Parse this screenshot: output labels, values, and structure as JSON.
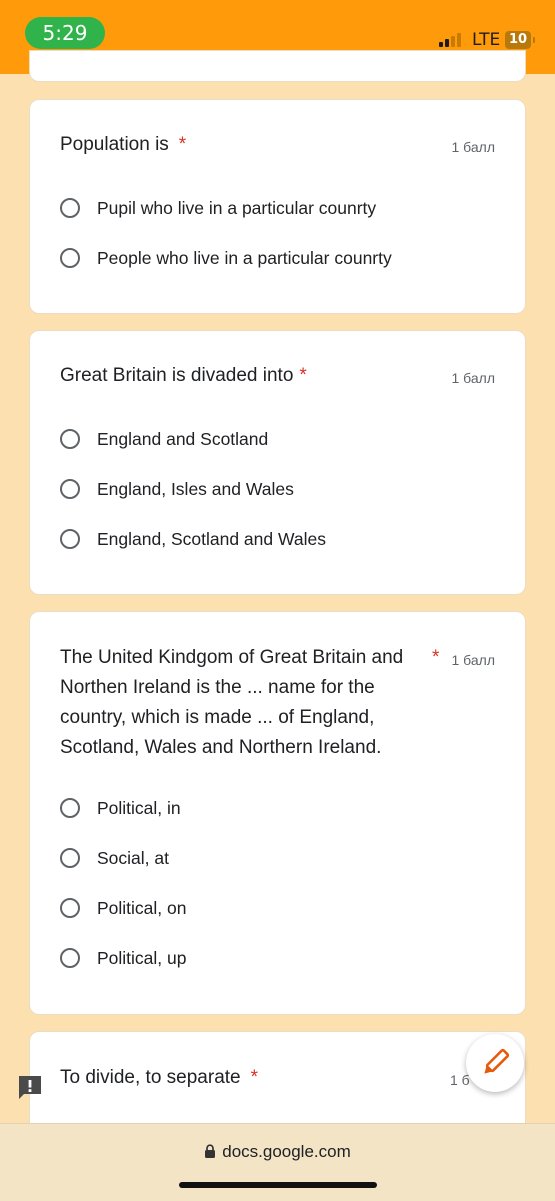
{
  "status_bar": {
    "time": "5:29",
    "network": "LTE",
    "battery": "10",
    "colors": {
      "bar": "#ff9b0a",
      "time_pill": "#2fb34a"
    }
  },
  "questions": [
    {
      "title": "Population is",
      "required": "*",
      "points": "1 балл",
      "options": [
        "Pupil who live in a particular counrty",
        "People who live in a particular counrty"
      ]
    },
    {
      "title": "Great Britain is divaded into",
      "required": "*",
      "points": "1 балл",
      "options": [
        "England and Scotland",
        "England, Isles and Wales",
        "England, Scotland and Wales"
      ]
    },
    {
      "title_lines": [
        "The United Kindgom of Great Britain and",
        "Northen Ireland is the ... name for the",
        "country, which is made ... of England,",
        "Scotland, Wales and Northern Ireland."
      ],
      "required": "*",
      "points": "1 балл",
      "options": [
        "Political, in",
        "Social, at",
        "Political, on",
        "Political, up"
      ]
    },
    {
      "title": "To divide, to separate",
      "required": "*",
      "points": "1 б"
    }
  ],
  "fab": {
    "icon": "pencil-icon"
  },
  "feedback": {
    "icon": "feedback-icon"
  },
  "browser": {
    "url": "docs.google.com",
    "lock_icon": "lock-icon"
  }
}
